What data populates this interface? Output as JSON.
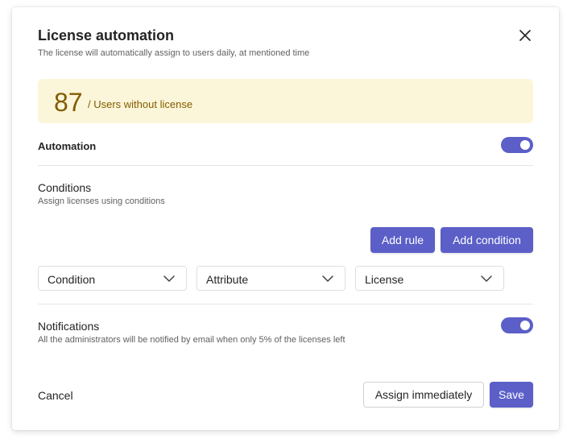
{
  "dialog": {
    "title": "License automation",
    "subtitle": "The license will automatically assign to users daily, at mentioned time",
    "close_icon": "close-icon"
  },
  "banner": {
    "count": "87",
    "label": "/ Users without license",
    "background_color": "#fbf6d9",
    "text_color": "#835b00"
  },
  "automation": {
    "label": "Automation",
    "toggle_on": true
  },
  "conditions": {
    "label": "Conditions",
    "description": "Assign licenses using conditions",
    "add_rule_label": "Add rule",
    "add_condition_label": "Add condition",
    "dropdowns": [
      {
        "value": "Condition",
        "icon": "chevron-down-icon"
      },
      {
        "value": "Attribute",
        "icon": "chevron-down-icon"
      },
      {
        "value": "License",
        "icon": "chevron-down-icon"
      }
    ]
  },
  "notifications": {
    "label": "Notifications",
    "description": "All the administrators will be notified by email when only 5% of the licenses left",
    "toggle_on": true
  },
  "footer": {
    "cancel_label": "Cancel",
    "assign_label": "Assign immediately",
    "save_label": "Save"
  },
  "colors": {
    "accent": "#5b5fc7",
    "text_primary": "#242424",
    "text_secondary": "#616161",
    "divider": "#e6e6e6"
  }
}
